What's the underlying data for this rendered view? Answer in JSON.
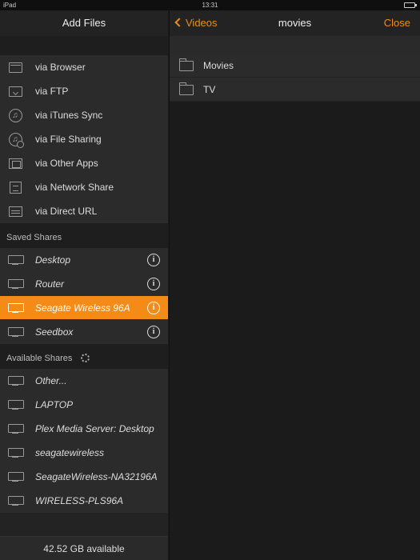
{
  "status_bar": {
    "device": "iPad",
    "time": "13:31"
  },
  "left_panel": {
    "title": "Add Files",
    "add_options": [
      {
        "label": "via Browser",
        "icon": "browser-icon"
      },
      {
        "label": "via FTP",
        "icon": "ftp-icon"
      },
      {
        "label": "via iTunes Sync",
        "icon": "itunes-icon"
      },
      {
        "label": "via File Sharing",
        "icon": "file-sharing-icon"
      },
      {
        "label": "via Other Apps",
        "icon": "other-apps-icon"
      },
      {
        "label": "via Network Share",
        "icon": "network-share-icon"
      },
      {
        "label": "via Direct URL",
        "icon": "direct-url-icon"
      }
    ],
    "saved_shares_header": "Saved Shares",
    "saved_shares": [
      {
        "label": "Desktop",
        "selected": false
      },
      {
        "label": "Router",
        "selected": false
      },
      {
        "label": "Seagate Wireless 96A",
        "selected": true
      },
      {
        "label": "Seedbox",
        "selected": false
      }
    ],
    "available_shares_header": "Available Shares",
    "available_shares": [
      {
        "label": "Other..."
      },
      {
        "label": "LAPTOP"
      },
      {
        "label": "Plex Media Server: Desktop"
      },
      {
        "label": "seagatewireless"
      },
      {
        "label": "SeagateWireless-NA32196A"
      },
      {
        "label": "WIRELESS-PLS96A"
      }
    ],
    "storage": "42.52 GB available"
  },
  "right_panel": {
    "back_label": "Videos",
    "title": "movies",
    "close_label": "Close",
    "folders": [
      {
        "label": "Movies"
      },
      {
        "label": "TV"
      }
    ]
  },
  "colors": {
    "accent": "#f38b16",
    "background": "#1b1b1b",
    "panel": "#2b2b2b"
  }
}
